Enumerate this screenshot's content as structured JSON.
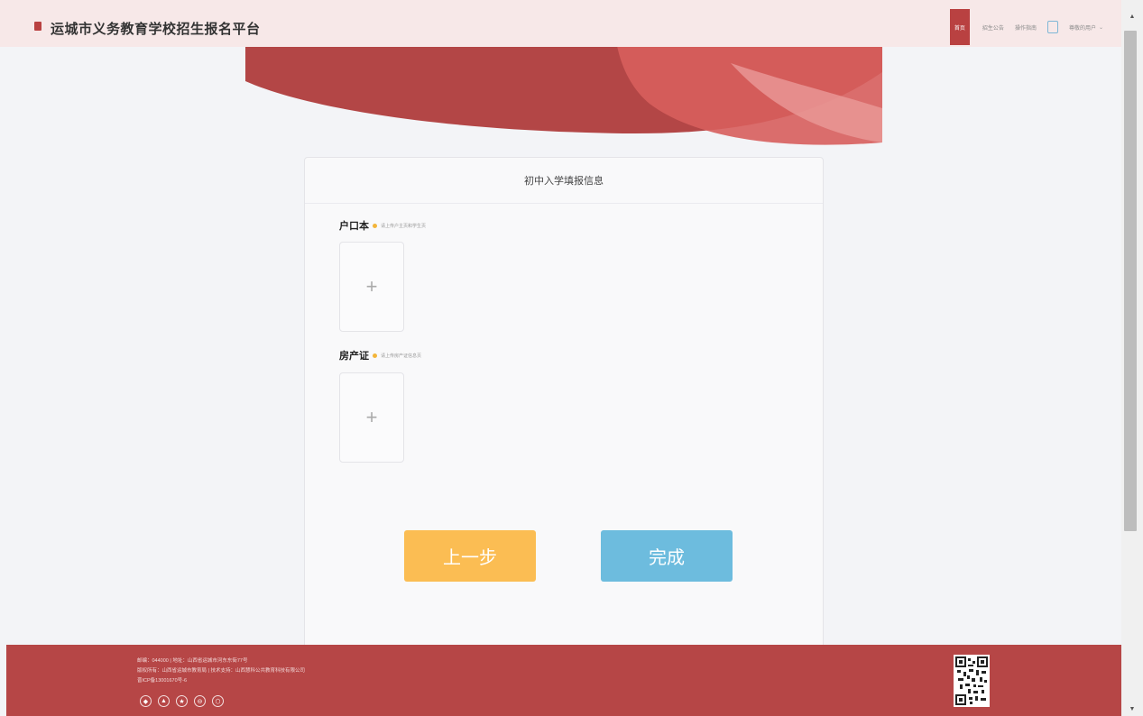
{
  "header": {
    "site_title": "运城市义务教育学校招生报名平台",
    "nav": {
      "home": "首页",
      "announcement": "招生公告",
      "guide": "操作指南",
      "user": "尊敬的用户"
    }
  },
  "form": {
    "title": "初中入学填报信息",
    "fields": [
      {
        "label": "户口本",
        "hint": "请上传户主页和学生页"
      },
      {
        "label": "房产证",
        "hint": "请上传房产证信息页"
      }
    ],
    "upload_symbol": "+",
    "buttons": {
      "prev": "上一步",
      "finish": "完成"
    }
  },
  "footer": {
    "lines": [
      "邮编：044000 | 地址：山西省运城市河东东街77号",
      "版权所有：山西省运城市教育局 | 技术支持：山西慧科公共教育科技有限公司",
      "晋ICP备13001670号-6"
    ]
  },
  "colors": {
    "brand_red": "#b94141",
    "prev_button": "#fbbd53",
    "finish_button": "#6dbcde"
  }
}
